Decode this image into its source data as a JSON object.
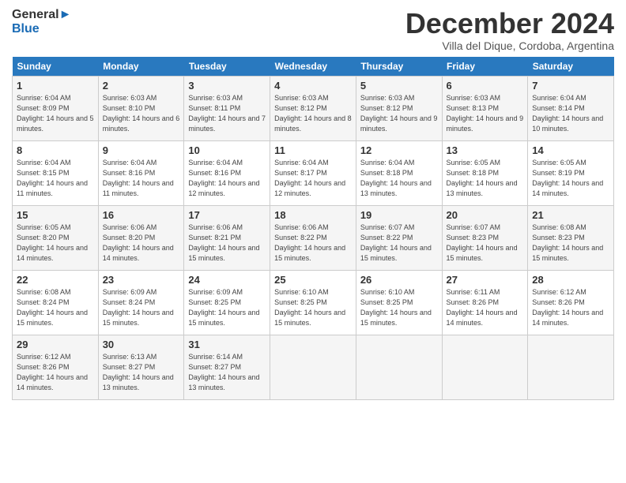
{
  "header": {
    "logo_line1": "General",
    "logo_line2": "Blue",
    "month_title": "December 2024",
    "subtitle": "Villa del Dique, Cordoba, Argentina"
  },
  "days_of_week": [
    "Sunday",
    "Monday",
    "Tuesday",
    "Wednesday",
    "Thursday",
    "Friday",
    "Saturday"
  ],
  "weeks": [
    [
      {
        "day": "1",
        "sunrise": "Sunrise: 6:04 AM",
        "sunset": "Sunset: 8:09 PM",
        "daylight": "Daylight: 14 hours and 5 minutes."
      },
      {
        "day": "2",
        "sunrise": "Sunrise: 6:03 AM",
        "sunset": "Sunset: 8:10 PM",
        "daylight": "Daylight: 14 hours and 6 minutes."
      },
      {
        "day": "3",
        "sunrise": "Sunrise: 6:03 AM",
        "sunset": "Sunset: 8:11 PM",
        "daylight": "Daylight: 14 hours and 7 minutes."
      },
      {
        "day": "4",
        "sunrise": "Sunrise: 6:03 AM",
        "sunset": "Sunset: 8:12 PM",
        "daylight": "Daylight: 14 hours and 8 minutes."
      },
      {
        "day": "5",
        "sunrise": "Sunrise: 6:03 AM",
        "sunset": "Sunset: 8:12 PM",
        "daylight": "Daylight: 14 hours and 9 minutes."
      },
      {
        "day": "6",
        "sunrise": "Sunrise: 6:03 AM",
        "sunset": "Sunset: 8:13 PM",
        "daylight": "Daylight: 14 hours and 9 minutes."
      },
      {
        "day": "7",
        "sunrise": "Sunrise: 6:04 AM",
        "sunset": "Sunset: 8:14 PM",
        "daylight": "Daylight: 14 hours and 10 minutes."
      }
    ],
    [
      {
        "day": "8",
        "sunrise": "Sunrise: 6:04 AM",
        "sunset": "Sunset: 8:15 PM",
        "daylight": "Daylight: 14 hours and 11 minutes."
      },
      {
        "day": "9",
        "sunrise": "Sunrise: 6:04 AM",
        "sunset": "Sunset: 8:16 PM",
        "daylight": "Daylight: 14 hours and 11 minutes."
      },
      {
        "day": "10",
        "sunrise": "Sunrise: 6:04 AM",
        "sunset": "Sunset: 8:16 PM",
        "daylight": "Daylight: 14 hours and 12 minutes."
      },
      {
        "day": "11",
        "sunrise": "Sunrise: 6:04 AM",
        "sunset": "Sunset: 8:17 PM",
        "daylight": "Daylight: 14 hours and 12 minutes."
      },
      {
        "day": "12",
        "sunrise": "Sunrise: 6:04 AM",
        "sunset": "Sunset: 8:18 PM",
        "daylight": "Daylight: 14 hours and 13 minutes."
      },
      {
        "day": "13",
        "sunrise": "Sunrise: 6:05 AM",
        "sunset": "Sunset: 8:18 PM",
        "daylight": "Daylight: 14 hours and 13 minutes."
      },
      {
        "day": "14",
        "sunrise": "Sunrise: 6:05 AM",
        "sunset": "Sunset: 8:19 PM",
        "daylight": "Daylight: 14 hours and 14 minutes."
      }
    ],
    [
      {
        "day": "15",
        "sunrise": "Sunrise: 6:05 AM",
        "sunset": "Sunset: 8:20 PM",
        "daylight": "Daylight: 14 hours and 14 minutes."
      },
      {
        "day": "16",
        "sunrise": "Sunrise: 6:06 AM",
        "sunset": "Sunset: 8:20 PM",
        "daylight": "Daylight: 14 hours and 14 minutes."
      },
      {
        "day": "17",
        "sunrise": "Sunrise: 6:06 AM",
        "sunset": "Sunset: 8:21 PM",
        "daylight": "Daylight: 14 hours and 15 minutes."
      },
      {
        "day": "18",
        "sunrise": "Sunrise: 6:06 AM",
        "sunset": "Sunset: 8:22 PM",
        "daylight": "Daylight: 14 hours and 15 minutes."
      },
      {
        "day": "19",
        "sunrise": "Sunrise: 6:07 AM",
        "sunset": "Sunset: 8:22 PM",
        "daylight": "Daylight: 14 hours and 15 minutes."
      },
      {
        "day": "20",
        "sunrise": "Sunrise: 6:07 AM",
        "sunset": "Sunset: 8:23 PM",
        "daylight": "Daylight: 14 hours and 15 minutes."
      },
      {
        "day": "21",
        "sunrise": "Sunrise: 6:08 AM",
        "sunset": "Sunset: 8:23 PM",
        "daylight": "Daylight: 14 hours and 15 minutes."
      }
    ],
    [
      {
        "day": "22",
        "sunrise": "Sunrise: 6:08 AM",
        "sunset": "Sunset: 8:24 PM",
        "daylight": "Daylight: 14 hours and 15 minutes."
      },
      {
        "day": "23",
        "sunrise": "Sunrise: 6:09 AM",
        "sunset": "Sunset: 8:24 PM",
        "daylight": "Daylight: 14 hours and 15 minutes."
      },
      {
        "day": "24",
        "sunrise": "Sunrise: 6:09 AM",
        "sunset": "Sunset: 8:25 PM",
        "daylight": "Daylight: 14 hours and 15 minutes."
      },
      {
        "day": "25",
        "sunrise": "Sunrise: 6:10 AM",
        "sunset": "Sunset: 8:25 PM",
        "daylight": "Daylight: 14 hours and 15 minutes."
      },
      {
        "day": "26",
        "sunrise": "Sunrise: 6:10 AM",
        "sunset": "Sunset: 8:25 PM",
        "daylight": "Daylight: 14 hours and 15 minutes."
      },
      {
        "day": "27",
        "sunrise": "Sunrise: 6:11 AM",
        "sunset": "Sunset: 8:26 PM",
        "daylight": "Daylight: 14 hours and 14 minutes."
      },
      {
        "day": "28",
        "sunrise": "Sunrise: 6:12 AM",
        "sunset": "Sunset: 8:26 PM",
        "daylight": "Daylight: 14 hours and 14 minutes."
      }
    ],
    [
      {
        "day": "29",
        "sunrise": "Sunrise: 6:12 AM",
        "sunset": "Sunset: 8:26 PM",
        "daylight": "Daylight: 14 hours and 14 minutes."
      },
      {
        "day": "30",
        "sunrise": "Sunrise: 6:13 AM",
        "sunset": "Sunset: 8:27 PM",
        "daylight": "Daylight: 14 hours and 13 minutes."
      },
      {
        "day": "31",
        "sunrise": "Sunrise: 6:14 AM",
        "sunset": "Sunset: 8:27 PM",
        "daylight": "Daylight: 14 hours and 13 minutes."
      },
      null,
      null,
      null,
      null
    ]
  ]
}
